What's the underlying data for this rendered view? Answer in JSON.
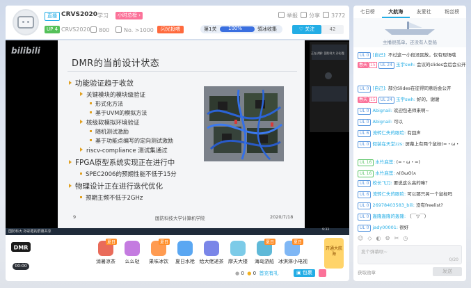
{
  "header": {
    "live_badge": "直播",
    "streamer": "CRVS2020",
    "category": "学习",
    "hourly_rank": "小时总榜 ›",
    "actions": [
      "举报",
      "分享",
      "3772"
    ],
    "up_level": "UP 4",
    "uid_name": "CRVS2020",
    "fans": "800",
    "rank_text": "No. >1000",
    "rise_button": "闪光投喂",
    "quest_label": "第1关",
    "quest_progress": "100%",
    "quest_reward": "領冰收集",
    "follow_button": "关注",
    "follow_count": "42"
  },
  "slide": {
    "title": "DMR的当前设计状态",
    "bullets": [
      {
        "level": 1,
        "text": "功能验证趋于收敛"
      },
      {
        "level": 2,
        "text": "关键模块的模块级验证"
      },
      {
        "level": 3,
        "text": "形式化方法"
      },
      {
        "level": 3,
        "text": "基于UVM的模拟方法"
      },
      {
        "level": 2,
        "text": "核级软模拟环境验证"
      },
      {
        "level": 3,
        "text": "随机测试激励"
      },
      {
        "level": 3,
        "text": "基于功能点编写的定向测试激励"
      },
      {
        "level": 2,
        "text": "riscv-compliance 测试集通过"
      },
      {
        "level": 1,
        "text": "FPGA原型系统实现正在进行中"
      },
      {
        "level": 2,
        "text": "SPEC2006的预期性能不低于15分"
      },
      {
        "level": 1,
        "text": "物理设计正在进行迭代优化"
      },
      {
        "level": 2,
        "text": "预期主频不低于2GHz"
      }
    ],
    "page": "9",
    "org": "国防科技大学计算机学院",
    "date": "2020/7/18"
  },
  "video_overlay": {
    "logo": "bilibili",
    "thumb_caption": "正在讲解: 国防科大 孙彩霞",
    "taskbar_title": "国防科大 孙彩霞的屏幕共享",
    "time": "9:33",
    "time_date": "2020/7/18"
  },
  "gifts": [
    {
      "name": "消暑凉茶",
      "tag": "夏日",
      "color": "#e96b5a"
    },
    {
      "name": "么么哒",
      "tag": "",
      "color": "#c47be0"
    },
    {
      "name": "果味冰饮",
      "tag": "夏日",
      "color": "#ff9b51"
    },
    {
      "name": "夏日水枪",
      "tag": "",
      "color": "#5aa7f2"
    },
    {
      "name": "给大佬递茶",
      "tag": "",
      "color": "#7a86e8"
    },
    {
      "name": "摩天大楼",
      "tag": "",
      "color": "#7ccbe8"
    },
    {
      "name": "海岛游船",
      "tag": "夏日",
      "color": "#5fb9d8"
    },
    {
      "name": "冰淇淋小电视",
      "tag": "夏日",
      "color": "#7fb7f5"
    }
  ],
  "giftbar": {
    "timer": "00:00",
    "dmr_logo": "DMR",
    "silver": "0",
    "gold": "0",
    "recharge": "首充有礼",
    "bag": "包裹",
    "voyage": "开通大航海"
  },
  "panel": {
    "tabs": [
      "七日榜",
      "大航海",
      "友爱社",
      "粉丝榜"
    ],
    "active_tab": 1,
    "banner_text": "主播很孤单，还没有人登船",
    "chat": [
      {
        "lv": "UL 0",
        "lvc": "b",
        "fan": "",
        "fanlv": "",
        "name": "[自己]:",
        "msg": "不过这一小段没回放，仅有现场哦"
      },
      {
        "lv": "",
        "lvc": "",
        "fan": "春天",
        "fanlv": "15",
        "name": "UL 24",
        "name2": "玉宇swh:",
        "msg": "会议的slides会后会公开吗？"
      },
      {
        "lv": "UL 0",
        "lvc": "b",
        "fan": "",
        "fanlv": "",
        "name": "[自己]:",
        "msg": "部分Slides在征得同意后会公开"
      },
      {
        "lv": "",
        "lvc": "",
        "fan": "春天",
        "fanlv": "15",
        "name": "UL 24",
        "name2": "玉宇swh:",
        "msg": "好的，谢谢"
      },
      {
        "lv": "UL 0",
        "lvc": "b",
        "fan": "",
        "fanlv": "",
        "name": "Abignail:",
        "msg": "欢迎包老师来啊~"
      },
      {
        "lv": "UL 0",
        "lvc": "b",
        "fan": "",
        "fanlv": "",
        "name": "Abignail:",
        "msg": "可以"
      },
      {
        "lv": "UL 6",
        "lvc": "b",
        "fan": "",
        "fanlv": "",
        "name": "流转仁失的眼睑:",
        "msg": "有回声"
      },
      {
        "lv": "UL 0",
        "lvc": "b",
        "fan": "",
        "fanlv": "",
        "name": "假装在天堂zzs:",
        "msg": "屏幕上有两个鼠标(=・ω・"
      },
      {
        "lv": "UL 16",
        "lvc": "g",
        "fan": "",
        "fanlv": "",
        "name": "水竹底莲:",
        "msg": "(=・ω・=)"
      },
      {
        "lv": "UL 16",
        "lvc": "g",
        "fan": "",
        "fanlv": "",
        "name": "水竹底莲:",
        "msg": "ʌ(ʘωʘ)ʌ"
      },
      {
        "lv": "UL 0",
        "lvc": "b",
        "fan": "",
        "fanlv": "",
        "name": "校长飞刀:",
        "msg": "要说这么高的嘛？"
      },
      {
        "lv": "UL 6",
        "lvc": "b",
        "fan": "",
        "fanlv": "",
        "name": "流转仁失的眼睑:",
        "msg": "可以那只另一个鼠标吗"
      },
      {
        "lv": "UL 0",
        "lvc": "b",
        "fan": "",
        "fanlv": "",
        "name": "26978403583_bili:",
        "msg": "没有freelist?"
      },
      {
        "lv": "UL 0",
        "lvc": "b",
        "fan": "",
        "fanlv": "",
        "name": "轰隆轰隆的轰隆:",
        "msg": "（￣▽￣）"
      },
      {
        "lv": "UL 0",
        "lvc": "b",
        "fan": "",
        "fanlv": "",
        "name": "jady00001:",
        "msg": "很好"
      }
    ],
    "input_placeholder": "发个弹幕呗~",
    "input_count": "0/20",
    "login_hint": "获取勋章",
    "send_button": "发送"
  },
  "colors": {
    "accent": "#23ade5",
    "pink": "#fb7299",
    "orange": "#ff6a3d"
  }
}
